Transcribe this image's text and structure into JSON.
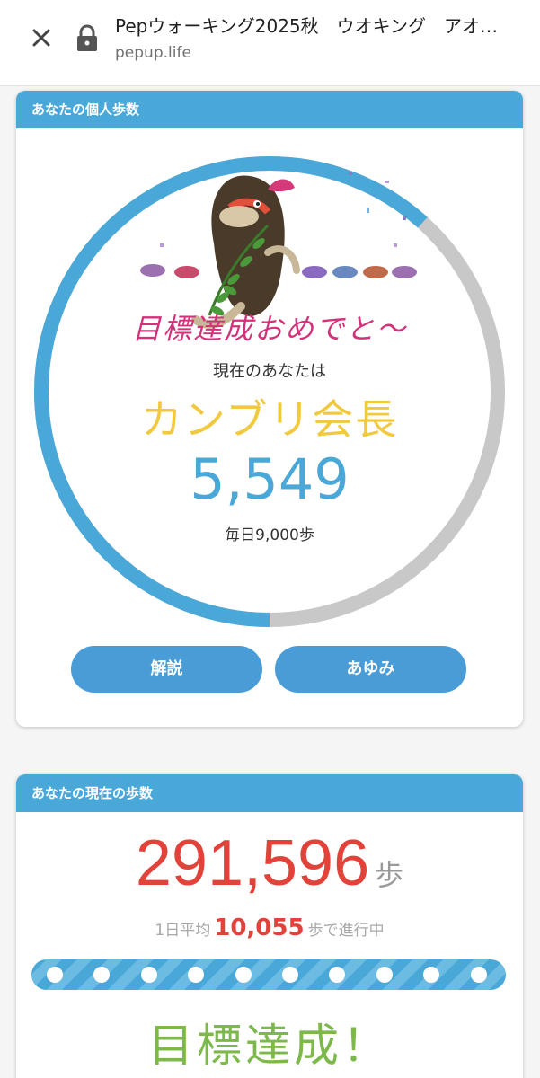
{
  "browser": {
    "title": "Pepウォーキング2025秋　ウオキング　アオ…",
    "url": "pepup.life",
    "close_icon": "close-icon",
    "lock_icon": "lock-icon"
  },
  "personal_card": {
    "header": "あなたの個人歩数",
    "congrats": "目標達成おめでと〜",
    "now_label": "現在のあなたは",
    "rank": "カンブリ会長",
    "steps": "5,549",
    "daily_goal": "毎日9,000歩",
    "progress_fraction": 0.617,
    "colors": {
      "ring": "#4aa8d8",
      "ring_bg": "#c8c8c8",
      "rank": "#f0c93e"
    },
    "buttons": {
      "explain": "解説",
      "history": "あゆみ"
    }
  },
  "current_card": {
    "header": "あなたの現在の歩数",
    "total_steps": "291,596",
    "unit": "歩",
    "avg_prefix": "1日平均",
    "avg_value": "10,055",
    "avg_suffix": "歩で進行中",
    "achieved": "目標達成！",
    "colors": {
      "total": "#e1423a",
      "achieved": "#7cb84a"
    }
  }
}
